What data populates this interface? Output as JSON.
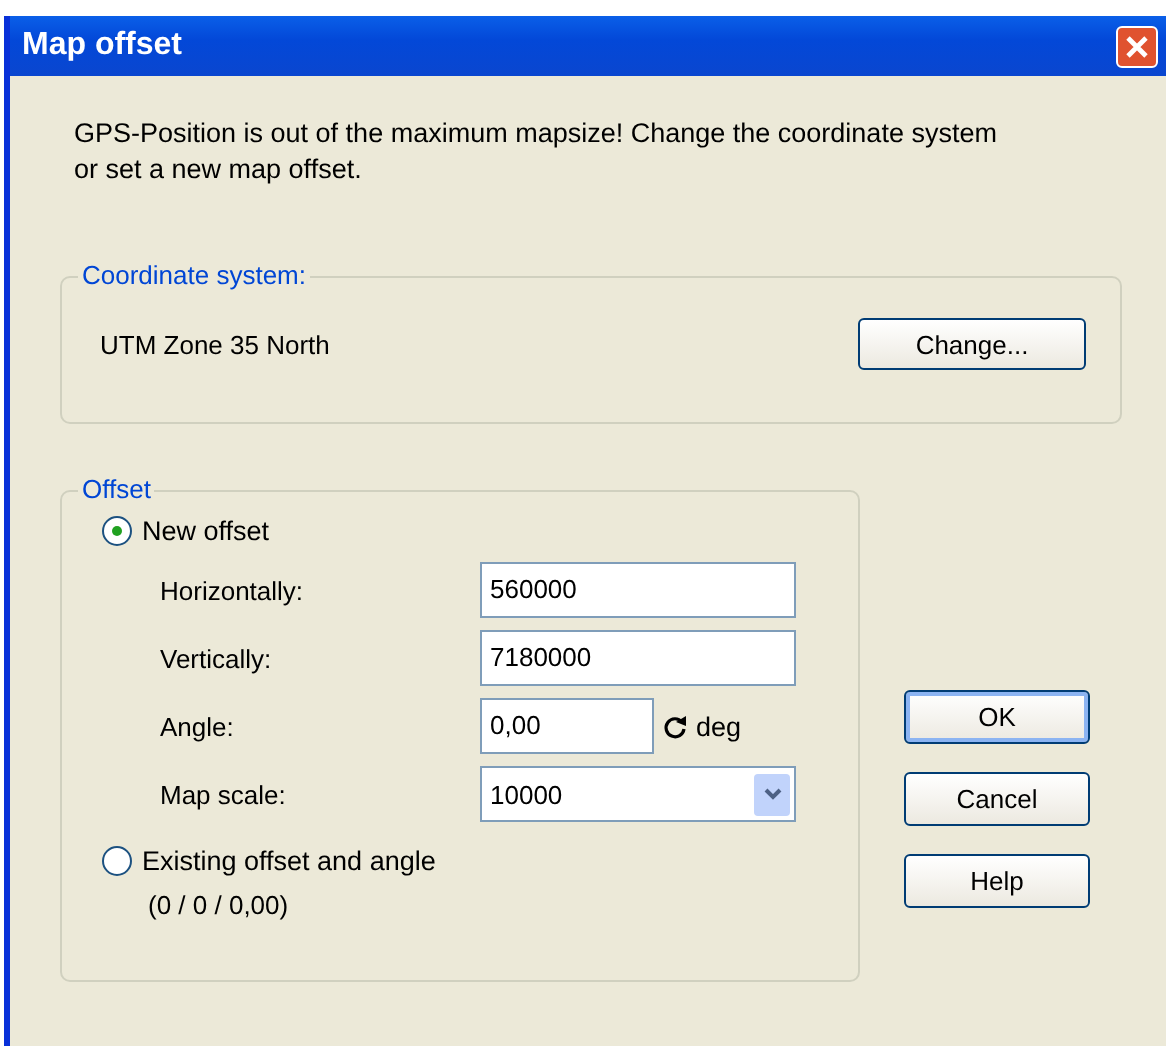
{
  "window": {
    "title": "Map offset"
  },
  "message": "GPS-Position is out of the maximum mapsize! Change the coordinate system or set a new map offset.",
  "coordinate_system": {
    "legend": "Coordinate system:",
    "value": "UTM Zone 35 North",
    "button": "Change..."
  },
  "offset": {
    "legend": "Offset",
    "options": [
      {
        "label": "New offset",
        "selected": true
      },
      {
        "label": "Existing offset and angle",
        "selected": false,
        "detail": "(0 / 0 / 0,00)"
      }
    ],
    "fields": [
      {
        "kind": "text",
        "label": "Horizontally:",
        "value": "560000"
      },
      {
        "kind": "text",
        "label": "Vertically:",
        "value": "7180000"
      },
      {
        "kind": "angle",
        "label": "Angle:",
        "value": "0,00",
        "unit": "deg"
      },
      {
        "kind": "dropdown",
        "label": "Map scale:",
        "value": "10000"
      }
    ]
  },
  "buttons": [
    {
      "label": "OK",
      "default": true
    },
    {
      "label": "Cancel",
      "default": false
    },
    {
      "label": "Help",
      "default": false
    }
  ]
}
